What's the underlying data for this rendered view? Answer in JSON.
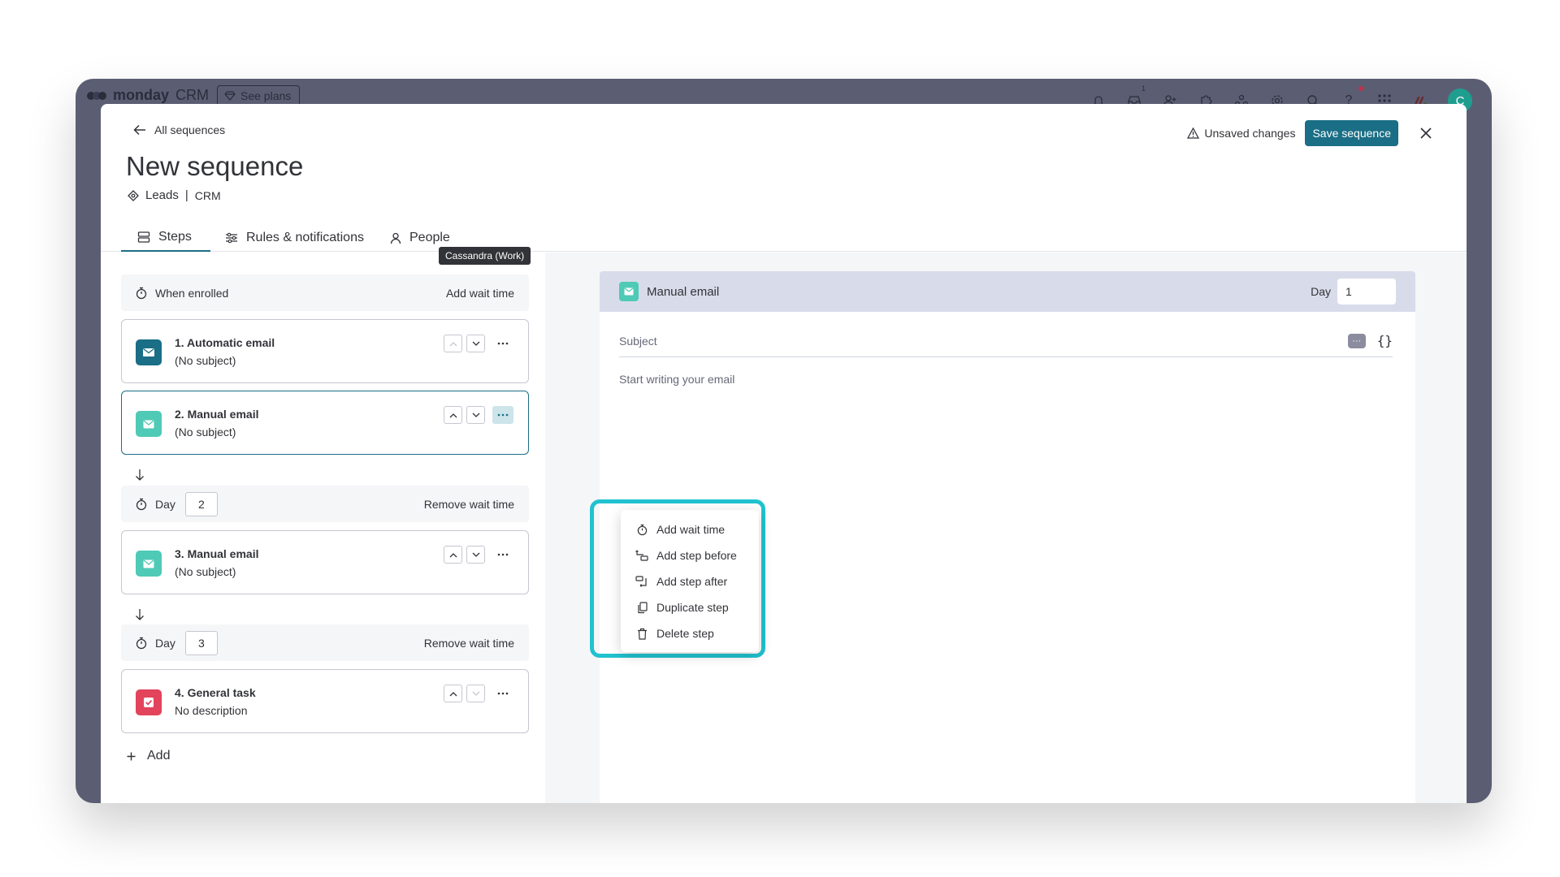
{
  "app": {
    "brand": "monday",
    "product": "CRM",
    "see_plans": "See plans",
    "inbox_count": "1",
    "avatar_initial": "C"
  },
  "header": {
    "back_label": "All sequences",
    "title": "New sequence",
    "board": "Leads",
    "workspace": "CRM",
    "separator": "|",
    "unsaved": "Unsaved changes",
    "save_label": "Save sequence"
  },
  "tabs": [
    {
      "label": "Steps",
      "active": true
    },
    {
      "label": "Rules & notifications",
      "active": false
    },
    {
      "label": "People",
      "active": false
    }
  ],
  "tooltip": "Cassandra (Work)",
  "enrolled": {
    "label": "When enrolled",
    "action": "Add wait time"
  },
  "steps": [
    {
      "title": "1. Automatic email",
      "subtitle": "(No subject)",
      "color": "#1a6e85"
    },
    {
      "title": "2. Manual email",
      "subtitle": "(No subject)",
      "color": "#4fcab6"
    },
    {
      "title": "3. Manual email",
      "subtitle": "(No subject)",
      "color": "#4fcab6"
    },
    {
      "title": "4. General task",
      "subtitle": "No description",
      "color": "#e2445c"
    }
  ],
  "waits": [
    {
      "label": "Day",
      "value": "2",
      "action": "Remove wait time"
    },
    {
      "label": "Day",
      "value": "3",
      "action": "Remove wait time"
    }
  ],
  "add_label": "Add",
  "editor": {
    "type_label": "Manual email",
    "day_label": "Day",
    "day_value": "1",
    "subject_placeholder": "Subject",
    "body_placeholder": "Start writing your email",
    "ai_chip": "···",
    "braces": "{}"
  },
  "menu": {
    "items": [
      {
        "label": "Add wait time"
      },
      {
        "label": "Add step before"
      },
      {
        "label": "Add step after"
      },
      {
        "label": "Duplicate step"
      },
      {
        "label": "Delete step"
      }
    ]
  },
  "colors": {
    "accent": "#1a6e85",
    "highlight": "#21c2cf",
    "manual_email": "#4fcab6",
    "task": "#e2445c"
  }
}
